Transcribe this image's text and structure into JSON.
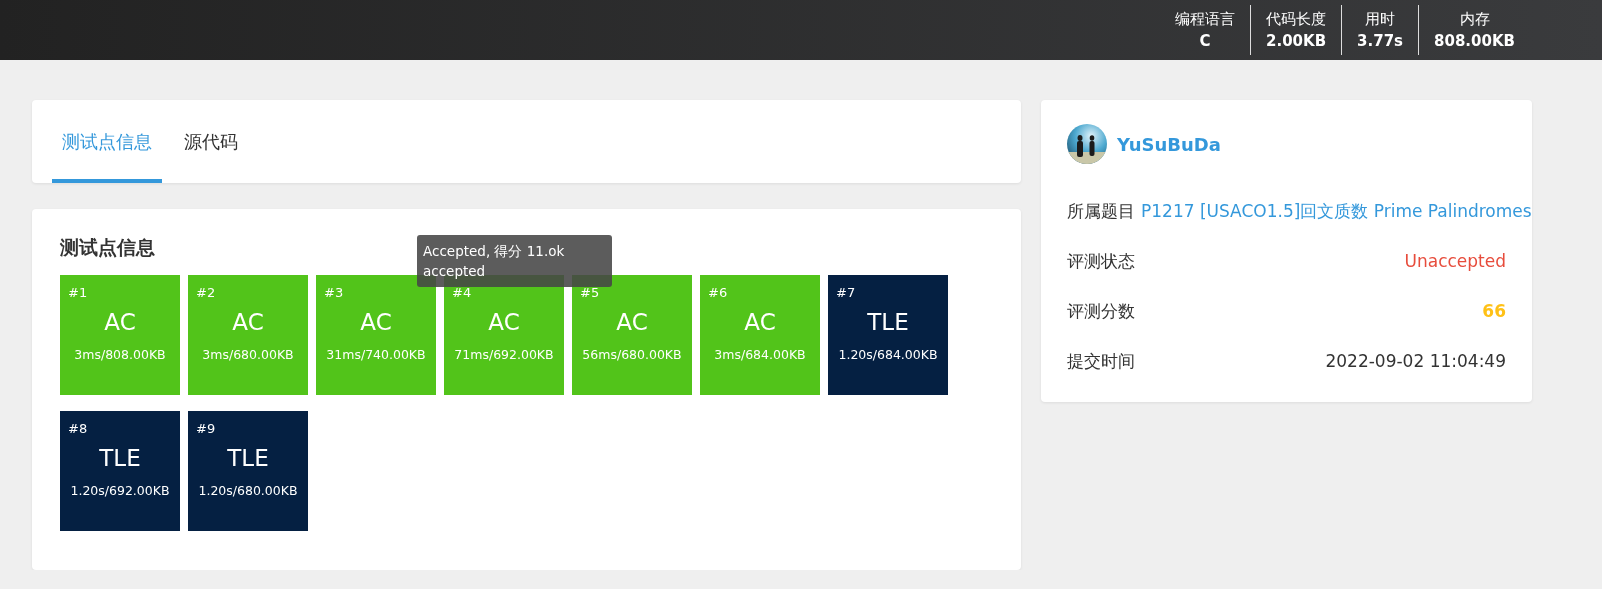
{
  "top_bar": {
    "stats": [
      {
        "label": "编程语言",
        "value": "C"
      },
      {
        "label": "代码长度",
        "value": "2.00KB"
      },
      {
        "label": "用时",
        "value": "3.77s"
      },
      {
        "label": "内存",
        "value": "808.00KB"
      }
    ]
  },
  "tabs": [
    {
      "label": "测试点信息",
      "selected": true
    },
    {
      "label": "源代码",
      "selected": false
    }
  ],
  "testcases": {
    "title": "测试点信息",
    "cases": [
      {
        "id": "#1",
        "status": "AC",
        "kind": "ac",
        "detail": "3ms/808.00KB"
      },
      {
        "id": "#2",
        "status": "AC",
        "kind": "ac",
        "detail": "3ms/680.00KB"
      },
      {
        "id": "#3",
        "status": "AC",
        "kind": "ac",
        "detail": "31ms/740.00KB"
      },
      {
        "id": "#4",
        "status": "AC",
        "kind": "ac",
        "detail": "71ms/692.00KB"
      },
      {
        "id": "#5",
        "status": "AC",
        "kind": "ac",
        "detail": "56ms/680.00KB"
      },
      {
        "id": "#6",
        "status": "AC",
        "kind": "ac",
        "detail": "3ms/684.00KB"
      },
      {
        "id": "#7",
        "status": "TLE",
        "kind": "tle",
        "detail": "1.20s/684.00KB"
      },
      {
        "id": "#8",
        "status": "TLE",
        "kind": "tle",
        "detail": "1.20s/692.00KB"
      },
      {
        "id": "#9",
        "status": "TLE",
        "kind": "tle",
        "detail": "1.20s/680.00KB"
      }
    ],
    "tooltip": {
      "lines": [
        "Accepted, 得分 11.ok",
        "accepted"
      ]
    }
  },
  "submission": {
    "user": "YuSuBuDa",
    "problem_label": "所属题目",
    "problem": "P1217 [USACO1.5]回文质数 Prime Palindromes",
    "fields": [
      {
        "label": "评测状态",
        "value": "Unaccepted",
        "kind": "status"
      },
      {
        "label": "评测分数",
        "value": "66",
        "kind": "score"
      },
      {
        "label": "提交时间",
        "value": "2022-09-02 11:04:49",
        "kind": "plain"
      }
    ]
  }
}
